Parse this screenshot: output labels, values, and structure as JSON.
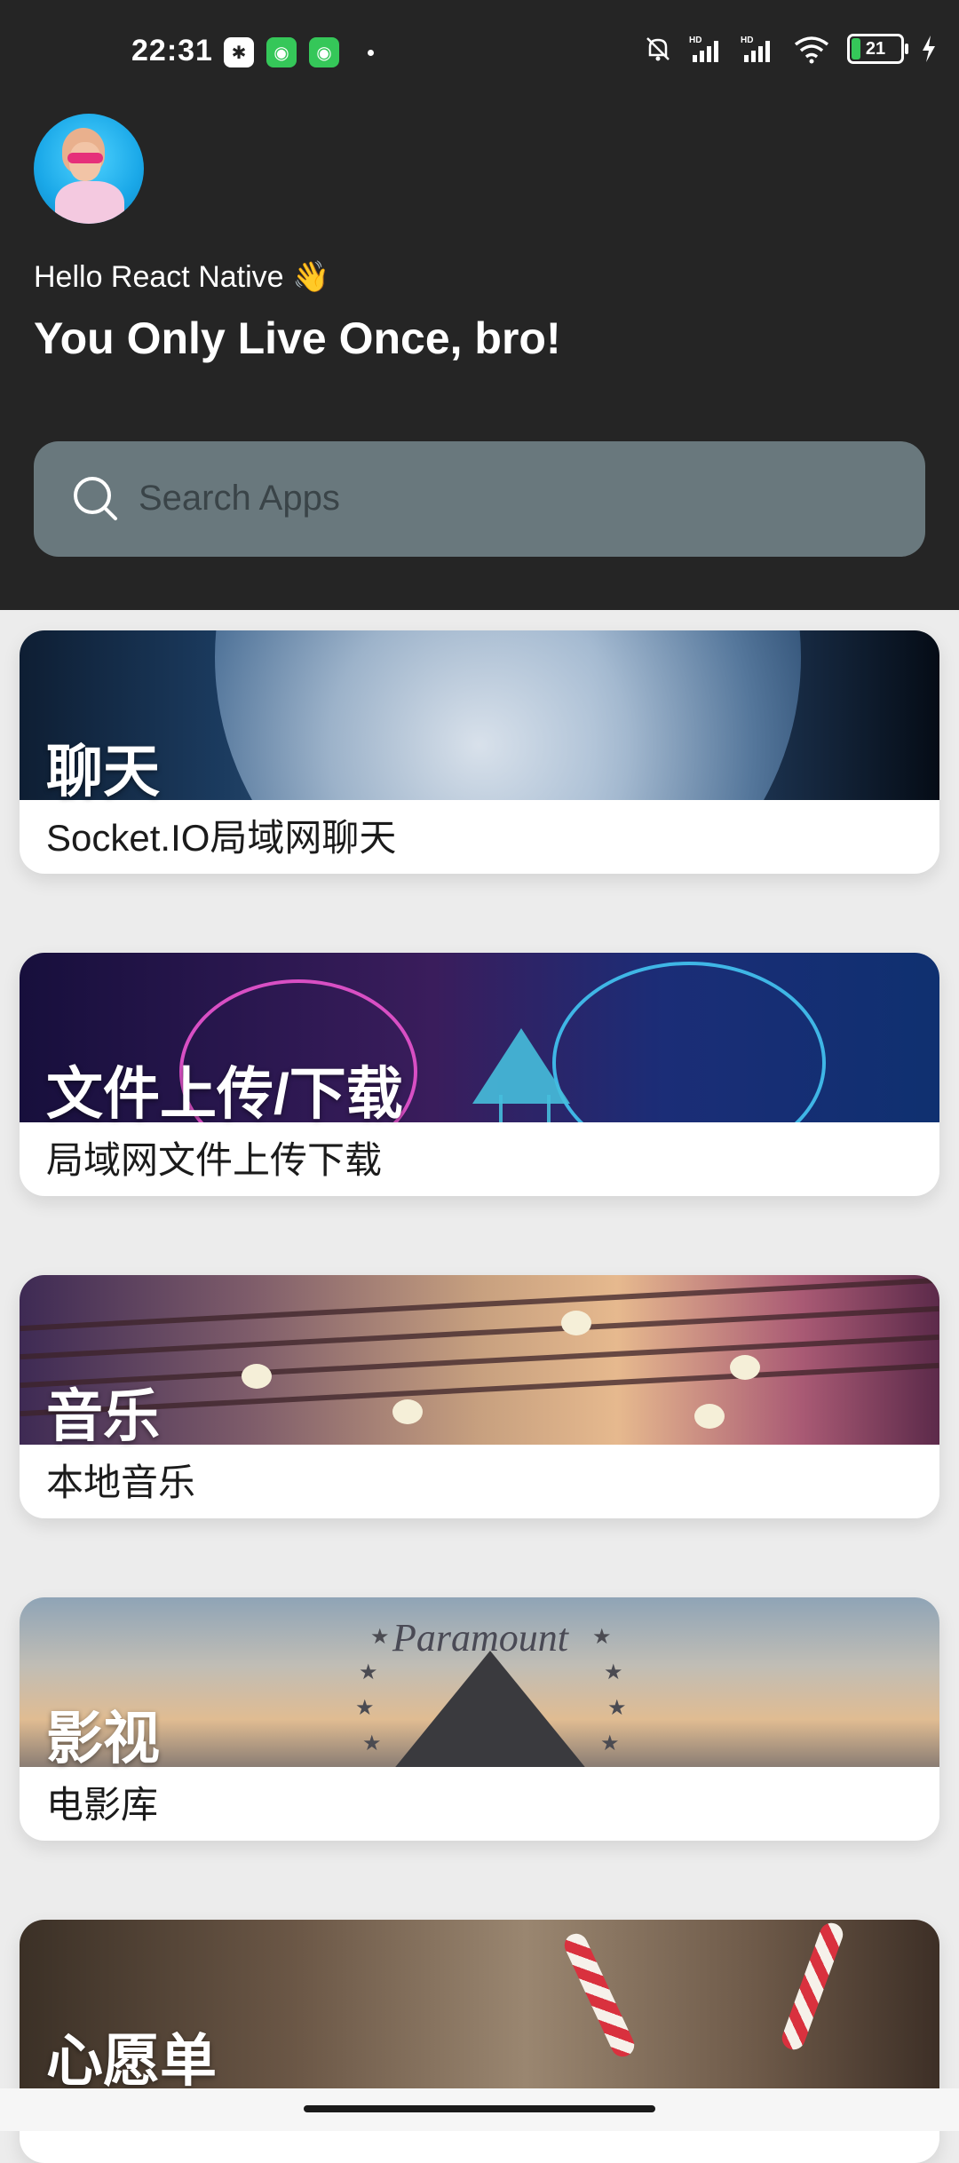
{
  "status_bar": {
    "time": "22:31",
    "left_icons": [
      "bluetooth-icon",
      "android-app-icon",
      "android-app-icon"
    ],
    "right_icons": [
      "mute-icon",
      "signal-hd-icon",
      "signal-hd-icon",
      "wifi-icon",
      "battery-icon",
      "charging-icon"
    ],
    "battery_level": "21",
    "hd_label": "HD"
  },
  "header": {
    "greeting": "Hello React Native 👋",
    "motto": "You Only Live Once, bro!"
  },
  "search": {
    "placeholder": "Search Apps"
  },
  "cards": [
    {
      "title": "聊天",
      "subtitle": "Socket.IO局域网聊天"
    },
    {
      "title": "文件上传/下载",
      "subtitle": "局域网文件上传下载"
    },
    {
      "title": "音乐",
      "subtitle": "本地音乐"
    },
    {
      "title": "影视",
      "subtitle": "电影库",
      "banner_text": "Paramount"
    },
    {
      "title": "心愿单",
      "subtitle": ""
    }
  ],
  "colors": {
    "header_bg": "#252525",
    "search_bg": "#69787d",
    "page_bg": "#ececec",
    "battery_green": "#35c759"
  }
}
